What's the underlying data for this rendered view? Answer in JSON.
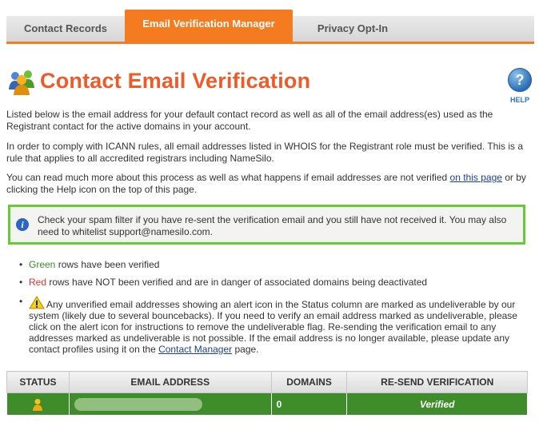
{
  "tabs": [
    {
      "label": "Contact Records"
    },
    {
      "label": "Email Verification Manager",
      "active": true
    },
    {
      "label": "Privacy Opt-In"
    }
  ],
  "header": {
    "title": "Contact Email Verification",
    "help_label": "HELP",
    "help_glyph": "?"
  },
  "intro": {
    "p1": "Listed below is the email address for your default contact record as well as all of the email address(es) used as the Registrant contact for the active domains in your account.",
    "p2": "In order to comply with ICANN rules, all email addresses listed in WHOIS for the Registrant role must be verified. This is a rule that applies to all accredited registrars including NameSilo.",
    "p3_before": "You can read much more about this process as well as what happens if email addresses are not verified ",
    "p3_link": "on this page",
    "p3_after": " or by clicking the Help icon on the top of this page."
  },
  "notice": {
    "icon": "info-icon",
    "text": "Check your spam filter if you have re-sent the verification email and you still have not received it. You may also need to whitelist support@namesilo.com."
  },
  "legend": {
    "green_word": "Green",
    "green_rest": " rows have been verified",
    "red_word": "Red",
    "red_rest": " rows have NOT been verified and are in danger of associated domains being deactivated",
    "warn_before": "Any unverified email addresses showing an alert icon in the Status column are marked as undeliverable by our system (likely due to several bouncebacks). If you need to verify an email address marked as undeliverable, please click on the alert icon for instructions to remove the undeliverable flag. Re-sending the verification email to any addresses marked as undeliverable is not possible. If the email address is no longer available, please update any contact profiles using it on the ",
    "warn_link": "Contact Manager",
    "warn_after": " page."
  },
  "table": {
    "headers": [
      "STATUS",
      "EMAIL ADDRESS",
      "DOMAINS",
      "RE-SEND VERIFICATION"
    ],
    "rows": [
      {
        "status_icon": "user-icon",
        "email": "",
        "domains": "0",
        "resend": "Verified",
        "color": "#3e8d2a"
      }
    ]
  },
  "colors": {
    "accent": "#f47b20",
    "title": "#f05a28",
    "notice_border": "#67cb33",
    "verified_row": "#3e8d2a"
  }
}
